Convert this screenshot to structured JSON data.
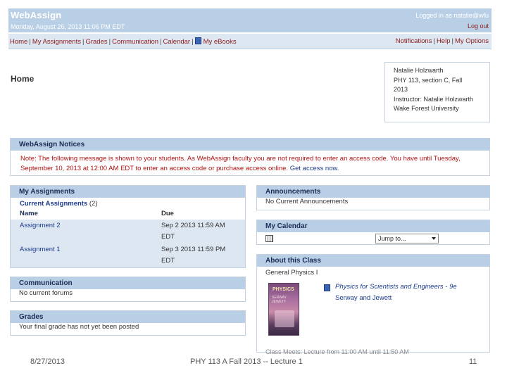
{
  "header": {
    "logo": "WebAssign",
    "date": "Monday, August 26, 2013 11:06 PM EDT",
    "logged_in": "Logged in as natalie@wfu",
    "logout": "Log out"
  },
  "nav": {
    "left": [
      "Home",
      "My Assignments",
      "Grades",
      "Communication",
      "Calendar"
    ],
    "ebooks": "My eBooks",
    "right": [
      "Notifications",
      "Help",
      "My Options"
    ]
  },
  "home_title": "Home",
  "info": {
    "lines": [
      "Natalie Holzwarth",
      "PHY 113, section C, Fall",
      "2013",
      "Instructor: Natalie Holzwarth",
      "Wake Forest University"
    ]
  },
  "notices": {
    "title": "WebAssign Notices",
    "text": "Note: The following message is shown to your students. As WebAssign faculty you are not required to enter an access code. You have until Tuesday, September 10, 2013 at 12:00 AM EDT to enter an access code or purchase access online.",
    "link": "Get access now."
  },
  "assignments": {
    "title": "My Assignments",
    "current_label": "Current Assignments",
    "current_count": "(2)",
    "col_name": "Name",
    "col_due": "Due",
    "rows": [
      {
        "name": "Assignment 2",
        "due1": "Sep 2 2013 11:59 AM",
        "due2": "EDT"
      },
      {
        "name": "Assignment 1",
        "due1": "Sep 3 2013 11:59 PM",
        "due2": "EDT"
      }
    ]
  },
  "communication": {
    "title": "Communication",
    "text": "No current forums"
  },
  "grades": {
    "title": "Grades",
    "text": "Your final grade has not yet been posted"
  },
  "announcements": {
    "title": "Announcements",
    "text": "No Current Announcements"
  },
  "calendar": {
    "title": "My Calendar",
    "jump": "Jump to..."
  },
  "about": {
    "title": "About this Class",
    "course": "General Physics I",
    "cover_title": "PHYSICS",
    "cover_authors": "SERWAY · JEWETT",
    "book_title": "Physics for Scientists and Engineers - 9e",
    "book_authors": "Serway and Jewett",
    "cut_text": "Class Meets: Lecture from 11:00 AM until 11:50 AM"
  },
  "footer": {
    "date": "8/27/2013",
    "center": "PHY 113 A  Fall 2013 -- Lecture 1",
    "slide": "11"
  }
}
